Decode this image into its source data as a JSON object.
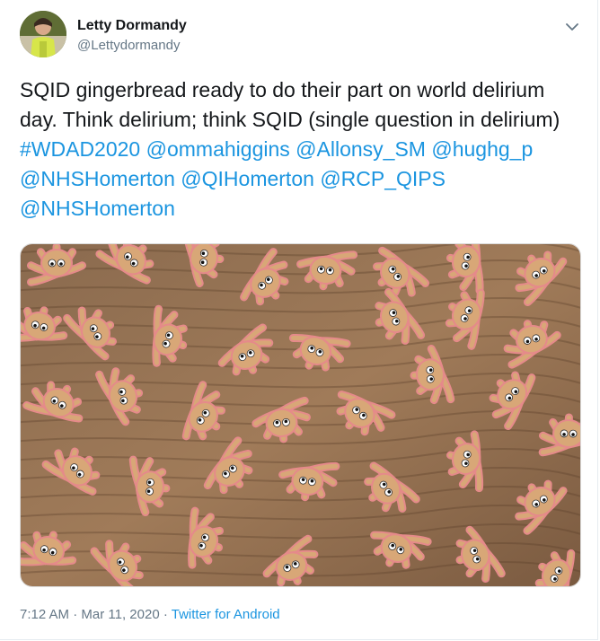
{
  "user": {
    "name": "Letty Dormandy",
    "handle": "@Lettydormandy"
  },
  "tweet": {
    "text_plain": "SQID gingerbread ready to do their part on world delirium day. Think delirium; think SQID (single question in delirium) ",
    "hashtag": "#WDAD2020",
    "mentions": [
      "@ommahiggins",
      "@Allonsy_SM",
      "@hughg_p",
      "@NHSHomerton",
      "@QIHomerton",
      "@RCP_QIPS",
      "@NHSHomerton"
    ]
  },
  "meta": {
    "time": "7:12 AM",
    "sep": " · ",
    "date": "Mar 11, 2020",
    "source": "Twitter for Android"
  },
  "icons": {
    "menu": "chevron-down-icon"
  },
  "colors": {
    "link": "#1b95e0",
    "secondary": "#657786",
    "text": "#14171a"
  }
}
